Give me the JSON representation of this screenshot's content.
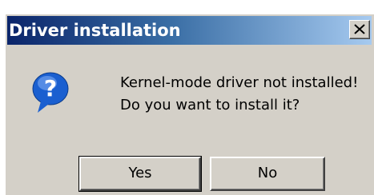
{
  "window": {
    "title": "Driver installation",
    "close_icon": "close-icon"
  },
  "message": {
    "icon": "question-icon",
    "line1": "Kernel-mode driver not installed!",
    "line2": "Do you want to install it?"
  },
  "buttons": {
    "yes_label": "Yes",
    "no_label": "No"
  },
  "colors": {
    "titlebar_start": "#0a246a",
    "titlebar_end": "#a6caf0",
    "dialog_face": "#d4d0c8",
    "icon_blue": "#1a5fd0"
  }
}
